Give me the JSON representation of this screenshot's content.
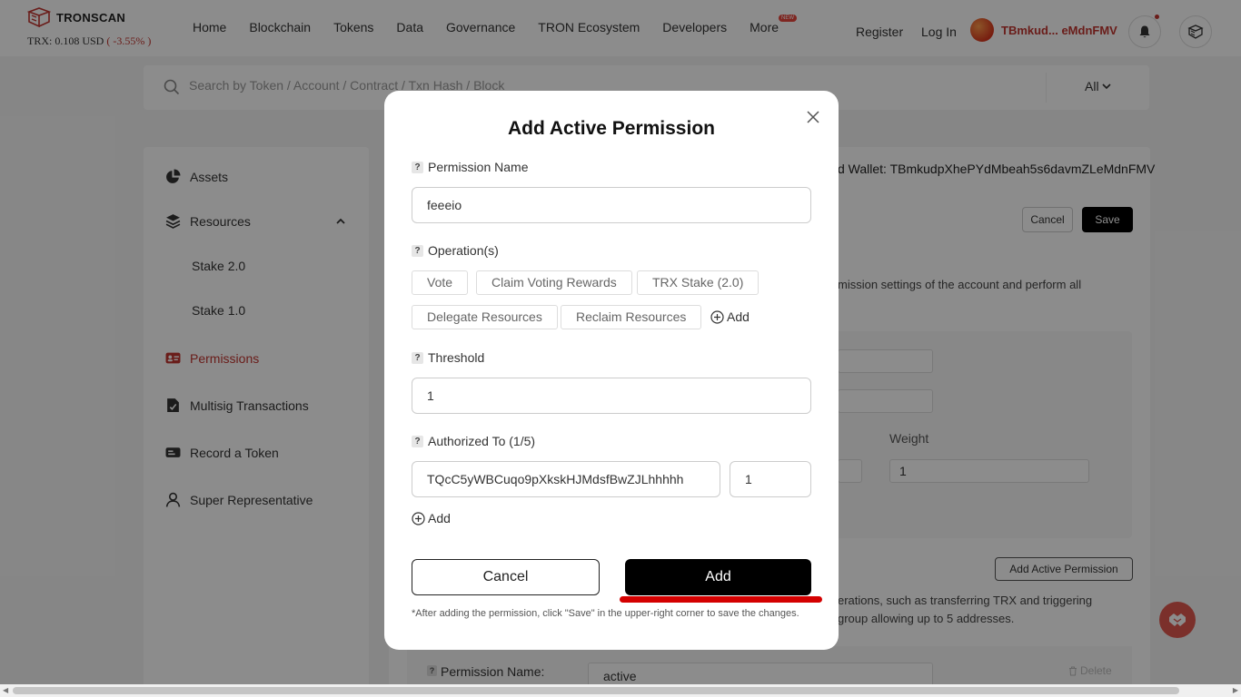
{
  "header": {
    "logo_text": "TRONSCAN",
    "price_prefix": "TRX: 0.108 USD",
    "price_change": "( -3.55% )",
    "nav": [
      "Home",
      "Blockchain",
      "Tokens",
      "Data",
      "Governance",
      "TRON Ecosystem",
      "Developers",
      "More"
    ],
    "new_badge": "NEW",
    "register": "Register",
    "login": "Log In",
    "wallet_short": "TBmkud... eMdnFMV"
  },
  "search": {
    "placeholder": "Search by Token / Account / Contract / Txn Hash / Block",
    "filter": "All"
  },
  "sidebar": {
    "assets": "Assets",
    "resources": "Resources",
    "stake2": "Stake 2.0",
    "stake1": "Stake 1.0",
    "permissions": "Permissions",
    "multisig": "Multisig Transactions",
    "record": "Record a Token",
    "sr": "Super Representative"
  },
  "main": {
    "wallet_line": "d Wallet: TBmkudpXhePYdMbeah5s6davmZLeMdnFMV",
    "cancel": "Cancel",
    "save": "Save",
    "desc1": "mission settings of the account and perform all",
    "weight_label": "Weight",
    "weight_value": "1",
    "add_active_btn": "Add Active Permission",
    "desc2_line1": "erations, such as transferring TRX and triggering",
    "desc2_line2": "group allowing up to 5 addresses.",
    "perm_name_label": "Permission Name:",
    "perm_name_value": "active",
    "delete": "Delete"
  },
  "modal": {
    "title": "Add Active Permission",
    "permission_name_label": "Permission Name",
    "permission_name_value": "feeeio",
    "operations_label": "Operation(s)",
    "operations": [
      "Vote",
      "Claim Voting Rewards",
      "TRX Stake (2.0)",
      "Delegate Resources",
      "Reclaim Resources"
    ],
    "add_label": "Add",
    "threshold_label": "Threshold",
    "threshold_value": "1",
    "authorized_label": "Authorized To (1/5)",
    "authorized_address": "TQcC5yWBCuqo9pXkskHJMdsfBwZJLhhhhh",
    "authorized_weight": "1",
    "cancel": "Cancel",
    "add_button": "Add",
    "note": "*After adding the permission, click \"Save\" in the upper-right corner to save the changes."
  },
  "colors": {
    "accent": "#c23631",
    "highlight": "#d40000",
    "primary_button": "#000000"
  }
}
